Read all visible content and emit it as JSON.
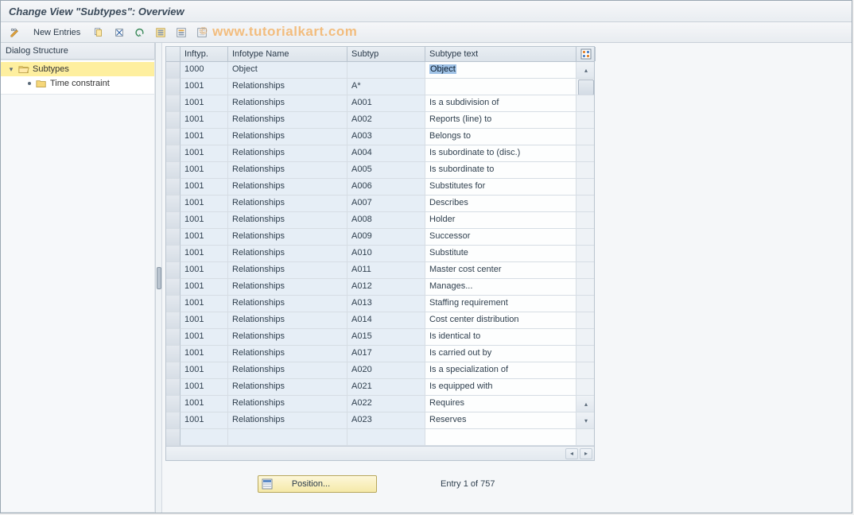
{
  "title": "Change View \"Subtypes\": Overview",
  "watermark": "www.tutorialkart.com",
  "toolbar": {
    "new_entries": "New Entries"
  },
  "dialog": {
    "header": "Dialog Structure",
    "root": "Subtypes",
    "child": "Time constraint"
  },
  "columns": {
    "inftyp": "Inftyp.",
    "infotype_name": "Infotype Name",
    "subtyp": "Subtyp",
    "subtype_text": "Subtype text"
  },
  "rows": [
    {
      "inftyp": "1000",
      "name": "Object",
      "subtyp": "",
      "text": "Object",
      "text_selected": true
    },
    {
      "inftyp": "1001",
      "name": "Relationships",
      "subtyp": "A*",
      "text": ""
    },
    {
      "inftyp": "1001",
      "name": "Relationships",
      "subtyp": "A001",
      "text": "Is a subdivision of"
    },
    {
      "inftyp": "1001",
      "name": "Relationships",
      "subtyp": "A002",
      "text": "Reports (line) to"
    },
    {
      "inftyp": "1001",
      "name": "Relationships",
      "subtyp": "A003",
      "text": "Belongs to"
    },
    {
      "inftyp": "1001",
      "name": "Relationships",
      "subtyp": "A004",
      "text": "Is subordinate to (disc.)"
    },
    {
      "inftyp": "1001",
      "name": "Relationships",
      "subtyp": "A005",
      "text": "Is subordinate to"
    },
    {
      "inftyp": "1001",
      "name": "Relationships",
      "subtyp": "A006",
      "text": "Substitutes for"
    },
    {
      "inftyp": "1001",
      "name": "Relationships",
      "subtyp": "A007",
      "text": "Describes"
    },
    {
      "inftyp": "1001",
      "name": "Relationships",
      "subtyp": "A008",
      "text": "Holder"
    },
    {
      "inftyp": "1001",
      "name": "Relationships",
      "subtyp": "A009",
      "text": "Successor"
    },
    {
      "inftyp": "1001",
      "name": "Relationships",
      "subtyp": "A010",
      "text": "Substitute"
    },
    {
      "inftyp": "1001",
      "name": "Relationships",
      "subtyp": "A011",
      "text": "Master cost center"
    },
    {
      "inftyp": "1001",
      "name": "Relationships",
      "subtyp": "A012",
      "text": "Manages..."
    },
    {
      "inftyp": "1001",
      "name": "Relationships",
      "subtyp": "A013",
      "text": "Staffing requirement"
    },
    {
      "inftyp": "1001",
      "name": "Relationships",
      "subtyp": "A014",
      "text": "Cost center distribution"
    },
    {
      "inftyp": "1001",
      "name": "Relationships",
      "subtyp": "A015",
      "text": "Is identical to"
    },
    {
      "inftyp": "1001",
      "name": "Relationships",
      "subtyp": "A017",
      "text": "Is carried out by"
    },
    {
      "inftyp": "1001",
      "name": "Relationships",
      "subtyp": "A020",
      "text": "Is a specialization of"
    },
    {
      "inftyp": "1001",
      "name": "Relationships",
      "subtyp": "A021",
      "text": "Is equipped with"
    },
    {
      "inftyp": "1001",
      "name": "Relationships",
      "subtyp": "A022",
      "text": "Requires"
    },
    {
      "inftyp": "1001",
      "name": "Relationships",
      "subtyp": "A023",
      "text": "Reserves"
    }
  ],
  "footer": {
    "position_label": "Position...",
    "entry_label": "Entry 1 of 757"
  }
}
